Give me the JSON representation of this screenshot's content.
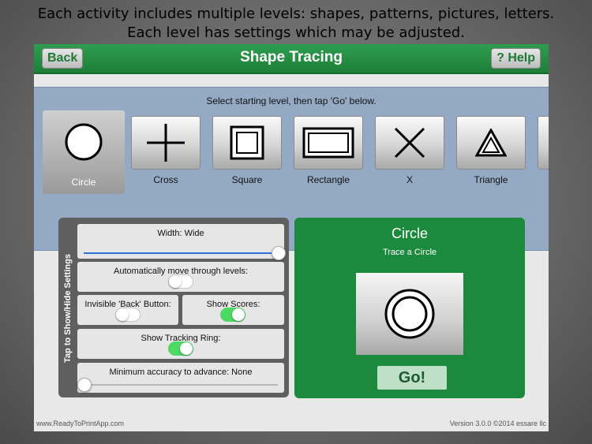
{
  "caption": {
    "line1": "Each activity includes multiple levels: shapes, patterns, pictures, letters.",
    "line2": "Each level has settings which may be adjusted."
  },
  "titlebar": {
    "back_label": "Back",
    "title": "Shape Tracing",
    "help_label": "? Help"
  },
  "levels": {
    "prompt": "Select starting level, then tap 'Go' below.",
    "items": [
      {
        "label": "Circle",
        "icon": "circle-icon",
        "selected": true
      },
      {
        "label": "Cross",
        "icon": "cross-icon"
      },
      {
        "label": "Square",
        "icon": "square-icon"
      },
      {
        "label": "Rectangle",
        "icon": "rectangle-icon"
      },
      {
        "label": "X",
        "icon": "x-icon"
      },
      {
        "label": "Triangle",
        "icon": "triangle-icon"
      }
    ]
  },
  "settings": {
    "tab_label": "Tap to Show/Hide Settings",
    "width_label": "Width: Wide",
    "width_fraction": 1.0,
    "auto_move_label": "Automatically move through levels:",
    "auto_move_on": false,
    "invisible_back_label": "Invisible 'Back' Button:",
    "invisible_back_on": false,
    "show_scores_label": "Show Scores:",
    "show_scores_on": true,
    "tracking_ring_label": "Show Tracking Ring:",
    "tracking_ring_on": true,
    "min_accuracy_label": "Minimum accuracy to advance: None",
    "min_accuracy_fraction": 0.0
  },
  "preview": {
    "title": "Circle",
    "subtitle": "Trace a Circle",
    "go_label": "Go!"
  },
  "footer": {
    "left": "www.ReadyToPrintApp.com",
    "right": "Version 3.0.0 ©2014 essare llc"
  },
  "colors": {
    "titlebar": "#1e7f38",
    "level_panel": "#94aac4",
    "preview_panel": "#1c8a3d",
    "slider_blue": "#2f6fd8",
    "toggle_on": "#4cd964"
  }
}
